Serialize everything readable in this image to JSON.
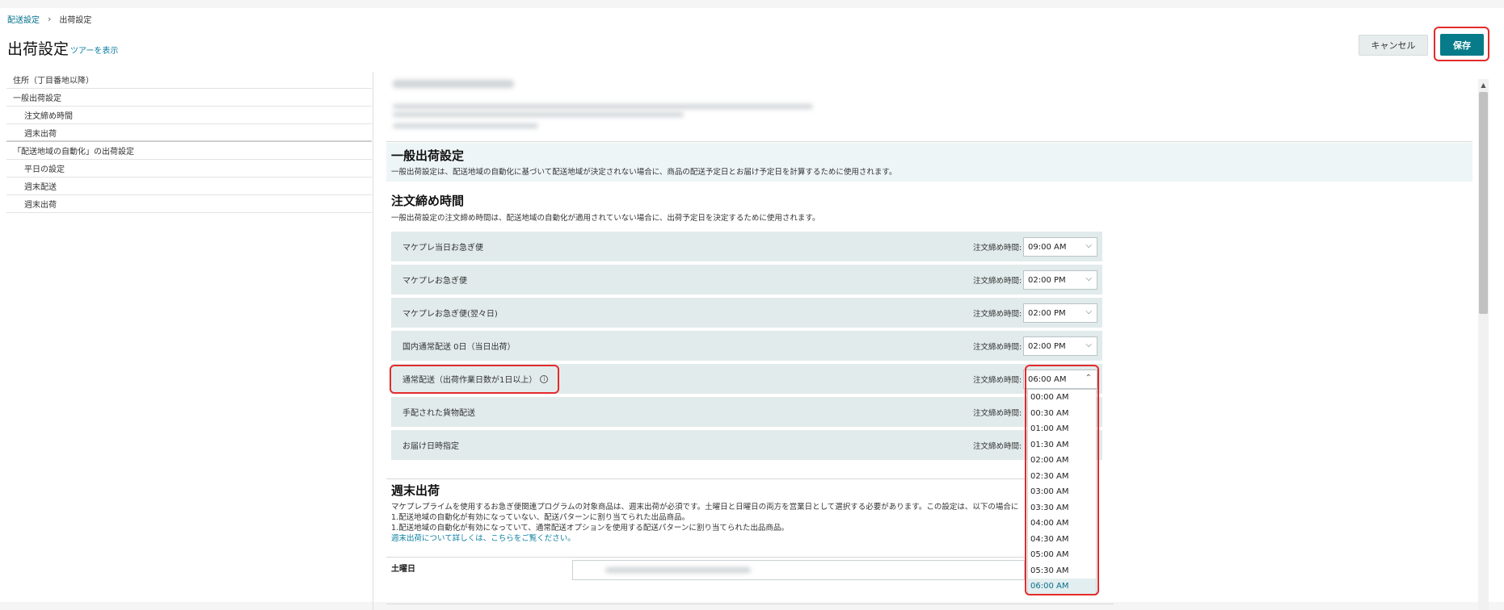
{
  "breadcrumb": {
    "parent": "配送設定",
    "separator": "›",
    "current": "出荷設定"
  },
  "header": {
    "title": "出荷設定",
    "tour_link": "ツアーを表示",
    "cancel_label": "キャンセル",
    "save_label": "保存"
  },
  "sidebar": {
    "items": [
      {
        "label": "住所（丁目番地以降）"
      },
      {
        "label": "一般出荷設定"
      },
      {
        "label": "注文締め時間"
      },
      {
        "label": "週末出荷"
      },
      {
        "label": "「配送地域の自動化」の出荷設定"
      },
      {
        "label": "平日の設定"
      },
      {
        "label": "週末配送"
      },
      {
        "label": "週末出荷"
      }
    ]
  },
  "general": {
    "title": "一般出荷設定",
    "description": "一般出荷設定は、配送地域の自動化に基づいて配送地域が決定されない場合に、商品の配送予定日とお届け予定日を計算するために使用されます。"
  },
  "cutoff": {
    "title": "注文締め時間",
    "description": "一般出荷設定の注文締め時間は、配送地域の自動化が適用されていない場合に、出荷予定日を決定するために使用されます。",
    "field_label": "注文締め時間:",
    "rows": [
      {
        "label": "マケプレ当日お急ぎ便",
        "value": "09:00 AM"
      },
      {
        "label": "マケプレお急ぎ便",
        "value": "02:00 PM"
      },
      {
        "label": "マケプレお急ぎ便(翌々日)",
        "value": "02:00 PM"
      },
      {
        "label": "国内通常配送 0日（当日出荷）",
        "value": "02:00 PM"
      },
      {
        "label": "通常配送（出荷作業日数が1日以上）",
        "value": "06:00 AM"
      },
      {
        "label": "手配された貨物配送",
        "value": ""
      },
      {
        "label": "お届け日時指定",
        "value": ""
      }
    ]
  },
  "dropdown": {
    "options": [
      "00:00 AM",
      "00:30 AM",
      "01:00 AM",
      "01:30 AM",
      "02:00 AM",
      "02:30 AM",
      "03:00 AM",
      "03:30 AM",
      "04:00 AM",
      "04:30 AM",
      "05:00 AM",
      "05:30 AM",
      "06:00 AM"
    ],
    "selected": "06:00 AM"
  },
  "weekend": {
    "title": "週末出荷",
    "line1": "マケプレプライムを使用するお急ぎ便関連プログラムの対象商品は、週末出荷が必須です。土曜日と日曜日の両方を営業日として選択する必要があります。この設定は、以下の場合に",
    "line2": "1.配送地域の自動化が有効になっていない、配送パターンに割り当てられた出品商品。",
    "line3": "1.配送地域の自動化が有効になっていて、通常配送オプションを使用する配送パターンに割り当てられた出品商品。",
    "link": "週末出荷について詳しくは、こちらをご覧ください。",
    "saturday_label": "土曜日"
  },
  "colors": {
    "accent": "#077b8a",
    "highlight": "#e32b2b",
    "row_bg": "#e2ebeb"
  }
}
